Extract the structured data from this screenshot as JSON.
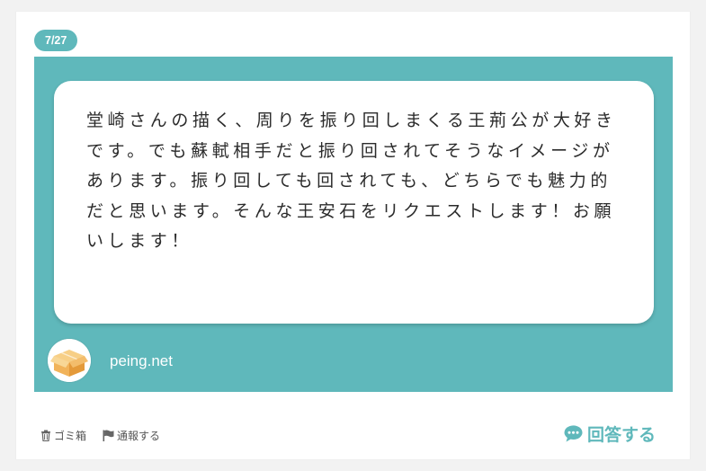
{
  "question": {
    "badge": "7/27",
    "text": "堂崎さんの描く、周りを振り回しまくる王荊公が大好きです。でも蘇軾相手だと振り回されてそうなイメージがあります。振り回しても回されても、どちらでも魅力的だと思います。そんな王安石をリクエストします！お願いします！",
    "site": "peing.net",
    "avatar_icon": "cardboard-box-icon"
  },
  "footer": {
    "trash_label": "ゴミ箱",
    "report_label": "通報する",
    "answer_label": "回答する",
    "trash_icon": "trash-icon",
    "report_icon": "flag-icon",
    "answer_icon": "speech-bubble-icon"
  },
  "colors": {
    "accent": "#5fb8bb",
    "background": "#f2f2f2",
    "card": "#ffffff"
  }
}
